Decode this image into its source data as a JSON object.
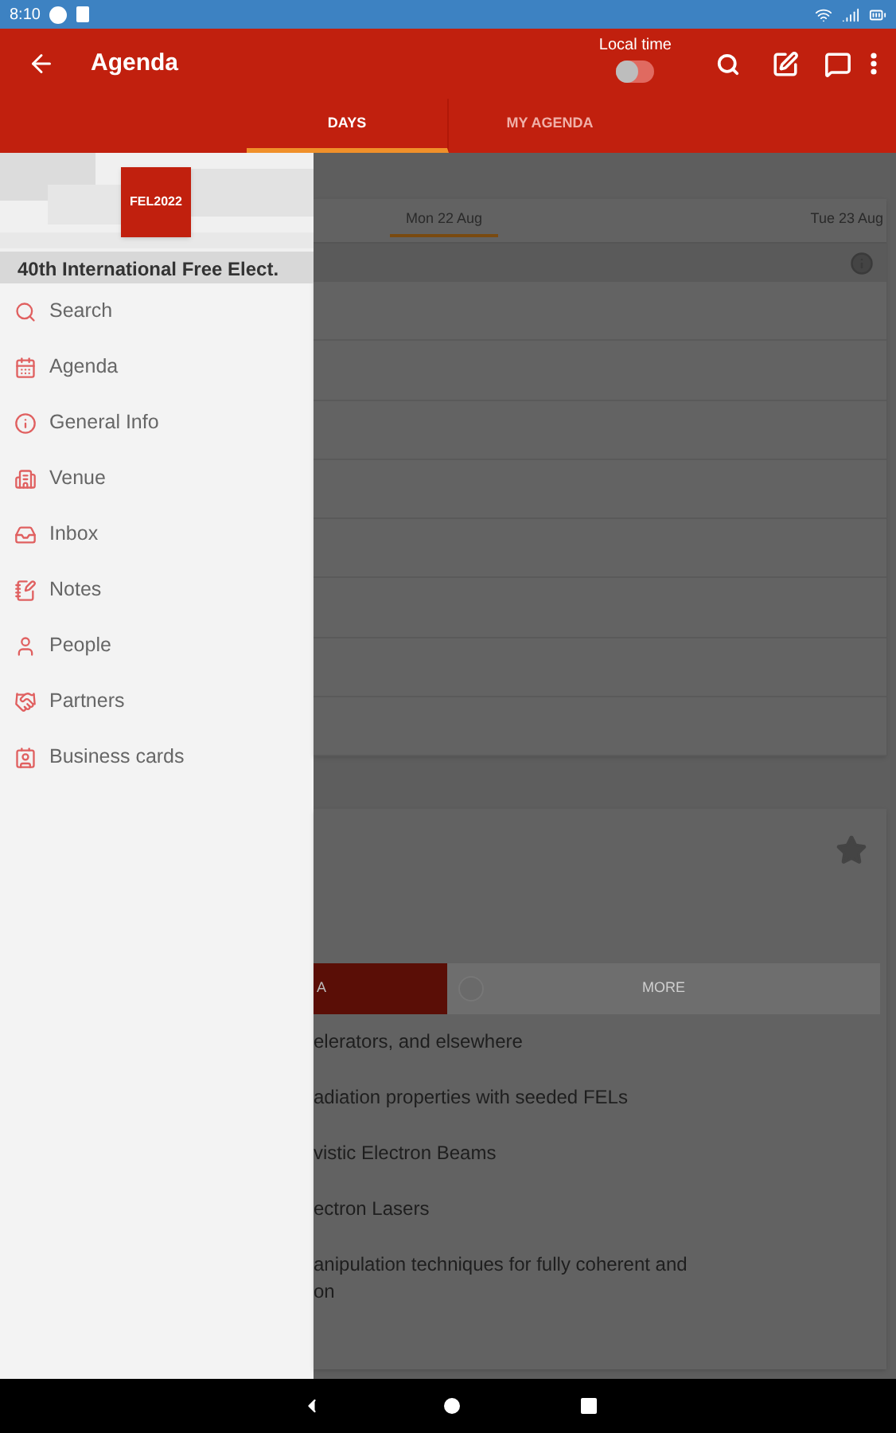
{
  "status_bar": {
    "time": "8:10"
  },
  "app_bar": {
    "title": "Agenda",
    "local_time": {
      "label": "Local time",
      "on": false
    }
  },
  "tabs": [
    {
      "label": "DAYS",
      "selected": true
    },
    {
      "label": "MY AGENDA",
      "selected": false
    }
  ],
  "drawer": {
    "logo": "FEL2022",
    "title": "40th International Free Elect.",
    "items": [
      {
        "label": "Search",
        "kind": "search"
      },
      {
        "label": "Agenda",
        "kind": "agenda"
      },
      {
        "label": "General Info",
        "kind": "info"
      },
      {
        "label": "Venue",
        "kind": "venue"
      },
      {
        "label": "Inbox",
        "kind": "inbox"
      },
      {
        "label": "Notes",
        "kind": "notes"
      },
      {
        "label": "People",
        "kind": "people"
      },
      {
        "label": "Partners",
        "kind": "partners"
      },
      {
        "label": "Business cards",
        "kind": "cards"
      }
    ]
  },
  "days": [
    {
      "label": "Mon 22 Aug",
      "selected": true
    },
    {
      "label": "Tue 23 Aug",
      "selected": false
    }
  ],
  "session_card": {
    "favorite": false,
    "segments": [
      {
        "label": "A",
        "selected": true
      },
      {
        "label": "MORE",
        "selected": false
      }
    ],
    "talks": [
      "elerators, and elsewhere",
      "adiation properties with seeded FELs",
      "vistic Electron Beams",
      "ectron Lasers",
      "anipulation techniques for fully coherent and\non"
    ]
  }
}
